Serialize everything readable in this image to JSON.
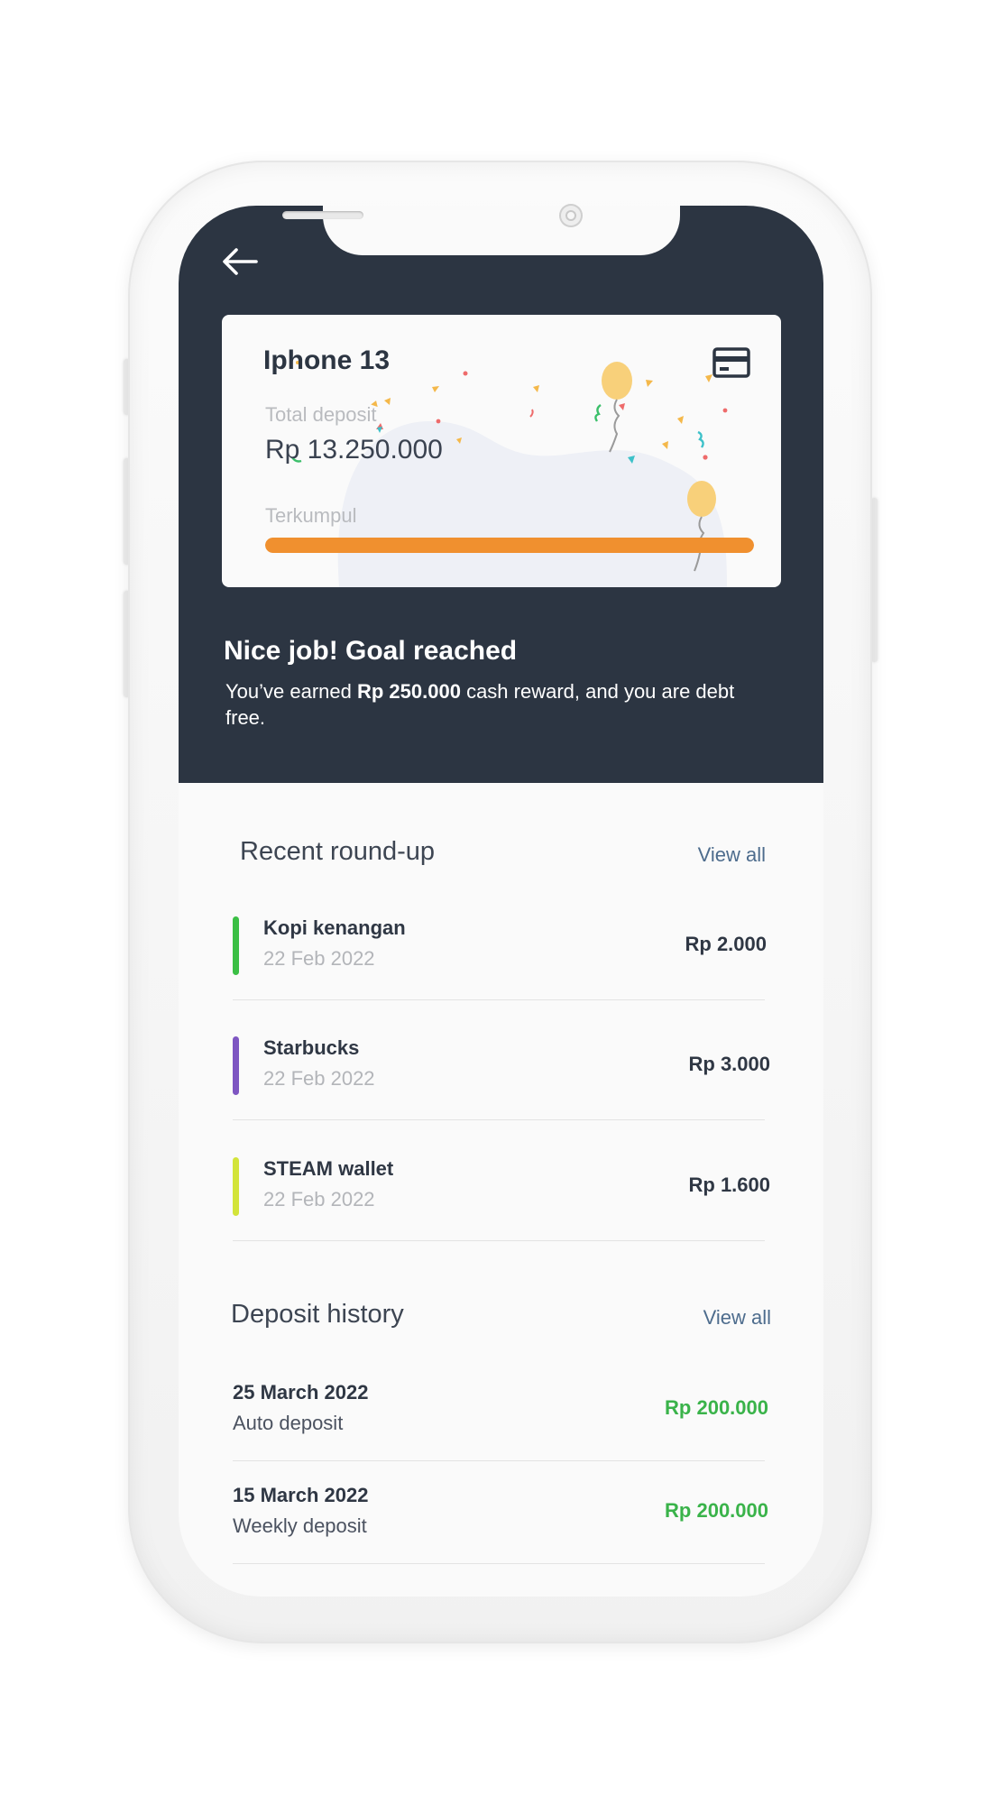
{
  "goal_card": {
    "title": "Iphone 13",
    "deposit_label": "Total deposit",
    "deposit_amount": "Rp 13.250.000",
    "progress_label": "Terkumpul",
    "progress_fraction": 1.0,
    "card_icon": "credit-card-icon"
  },
  "header": {
    "back_icon": "arrow-left-icon"
  },
  "goal_message": {
    "title": "Nice job! Goal reached",
    "text_before": "You’ve earned ",
    "reward": "Rp 250.000",
    "text_after": " cash reward, and you are debt free."
  },
  "roundup": {
    "title": "Recent round-up",
    "view_all": "View all",
    "items": [
      {
        "name": "Kopi kenangan",
        "date": "22 Feb 2022",
        "amount": "Rp 2.000",
        "color": "#3bbf45"
      },
      {
        "name": "Starbucks",
        "date": "22 Feb 2022",
        "amount": "Rp 3.000",
        "color": "#7e56c2"
      },
      {
        "name": "STEAM wallet",
        "date": "22 Feb 2022",
        "amount": "Rp 1.600",
        "color": "#d3e43a"
      }
    ]
  },
  "deposit_history": {
    "title": "Deposit history",
    "view_all": "View all",
    "items": [
      {
        "date": "25 March 2022",
        "type": "Auto deposit",
        "amount": "Rp 200.000"
      },
      {
        "date": "15 March 2022",
        "type": "Weekly deposit",
        "amount": "Rp 200.000"
      }
    ]
  },
  "colors": {
    "header_bg": "#2c3542",
    "progress": "#f0902f",
    "deposit_amount": "#3ab34a",
    "link": "#4d6c8d"
  }
}
